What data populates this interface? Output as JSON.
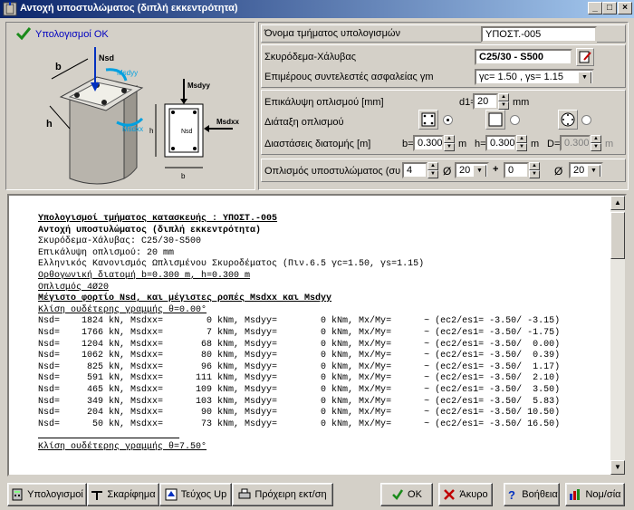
{
  "window": {
    "title": "Αντοχή υποστυλώματος (διπλή εκκεντρότητα)",
    "buttons": [
      "_",
      "□",
      "×"
    ]
  },
  "status": {
    "text": "Υπολογισμοί ΟΚ"
  },
  "diagram": {
    "labels": {
      "nsd": "Nsd",
      "msdyy": "Msdyy",
      "msdxx": "Msdxx",
      "b": "b",
      "h": "h"
    }
  },
  "form": {
    "section_name_label": "Όνομα τμήματος υπολογισμών",
    "section_name_value": "ΥΠΟΣΤ.-005",
    "materials_label": "Σκυρόδεμα-Χάλυβας",
    "materials_value": "C25/30 - S500",
    "safety_label": "Επιμέρους συντελεστές ασφαλείας γm",
    "safety_value": "γc= 1.50 , γs= 1.15",
    "cover_label": "Επικάλυψη οπλισμού [mm]",
    "cover_prefix": "d1=",
    "cover_value": "20",
    "cover_unit": "mm",
    "arrangement_label": "Διάταξη οπλισμού",
    "dims_label": "Διαστάσεις διατομής [m]",
    "b_prefix": "b=",
    "b_value": "0.300",
    "b_unit": "m",
    "h_prefix": "h=",
    "h_value": "0.300",
    "h_unit": "m",
    "d_prefix": "D=",
    "d_value": "0.300",
    "d_unit": "m",
    "rebar_label": "Οπλισμός υποστυλώματος (συνολ",
    "rebar_n1": "4",
    "rebar_d1": "20",
    "plus": "+",
    "rebar_n2": "0",
    "rebar_d2": "20",
    "phi": "Ø"
  },
  "report": {
    "lines": [
      {
        "t": "Υπολογισμοί τμήματος κατασκευής : ΥΠΟΣΤ.-005",
        "s": "bu"
      },
      {
        "t": "Αντοχή υποστυλώματος (διπλή εκκεντρότητα)",
        "s": "b"
      },
      {
        "t": "Σκυρόδεμα-Χάλυβας: C25/30-S500",
        "s": ""
      },
      {
        "t": "Επικάλυψη οπλισμού: 20 mm",
        "s": ""
      },
      {
        "t": "Ελληνικός Κανονισμός Ωπλισμένου Σκυροδέματος (Πιν.6.5 γc=1.50, γs=1.15)",
        "s": ""
      },
      {
        "t": "Ορθογωνική διατομή b=0.300 m, h=0.300 m",
        "s": "u"
      },
      {
        "t": "Οπλισμός 4Ø20",
        "s": "u"
      },
      {
        "t": "Μέγιστο φορτίο Nsd, και μέγιστες ροπές Msdxx και Msdyy",
        "s": "bu"
      },
      {
        "t": "Κλίση ουδέτερης γραμμής θ=0.00°",
        "s": "u"
      },
      {
        "t": "Nsd=    1824 kN, Msdxx=        0 kNm, Msdyy=        0 kNm, Mx/My=      ~ (ec2/es1= -3.50/ -3.15)",
        "s": ""
      },
      {
        "t": "Nsd=    1766 kN, Msdxx=        7 kNm, Msdyy=        0 kNm, Mx/My=      ~ (ec2/es1= -3.50/ -1.75)",
        "s": ""
      },
      {
        "t": "Nsd=    1204 kN, Msdxx=       68 kNm, Msdyy=        0 kNm, Mx/My=      ~ (ec2/es1= -3.50/  0.00)",
        "s": ""
      },
      {
        "t": "Nsd=    1062 kN, Msdxx=       80 kNm, Msdyy=        0 kNm, Mx/My=      ~ (ec2/es1= -3.50/  0.39)",
        "s": ""
      },
      {
        "t": "Nsd=     825 kN, Msdxx=       96 kNm, Msdyy=        0 kNm, Mx/My=      ~ (ec2/es1= -3.50/  1.17)",
        "s": ""
      },
      {
        "t": "Nsd=     591 kN, Msdxx=      111 kNm, Msdyy=        0 kNm, Mx/My=      ~ (ec2/es1= -3.50/  2.10)",
        "s": ""
      },
      {
        "t": "Nsd=     465 kN, Msdxx=      109 kNm, Msdyy=        0 kNm, Mx/My=      ~ (ec2/es1= -3.50/  3.50)",
        "s": ""
      },
      {
        "t": "Nsd=     349 kN, Msdxx=      103 kNm, Msdyy=        0 kNm, Mx/My=      ~ (ec2/es1= -3.50/  5.83)",
        "s": ""
      },
      {
        "t": "Nsd=     204 kN, Msdxx=       90 kNm, Msdyy=        0 kNm, Mx/My=      ~ (ec2/es1= -3.50/ 10.50)",
        "s": ""
      },
      {
        "t": "Nsd=      50 kN, Msdxx=       73 kNm, Msdyy=        0 kNm, Mx/My=      ~ (ec2/es1= -3.50/ 16.50)",
        "s": ""
      },
      {
        "t": "                          ",
        "s": "u"
      },
      {
        "t": "Κλίση ουδέτερης γραμμής θ=7.50°",
        "s": "u"
      }
    ]
  },
  "toolbar": {
    "calc": "Υπολογισμοί",
    "sketch": "Σκαρίφημα",
    "booklet": "Τεύχος Up",
    "draft": "Πρόχειρη εκτ/ση",
    "ok": "ΟΚ",
    "cancel": "Άκυρο",
    "help": "Βοήθεια",
    "units": "Νομ/σία"
  },
  "colors": {
    "title_start": "#0a246a",
    "title_end": "#a6caf0",
    "check": "#1a8a1a",
    "moment": "#00a0e0"
  }
}
